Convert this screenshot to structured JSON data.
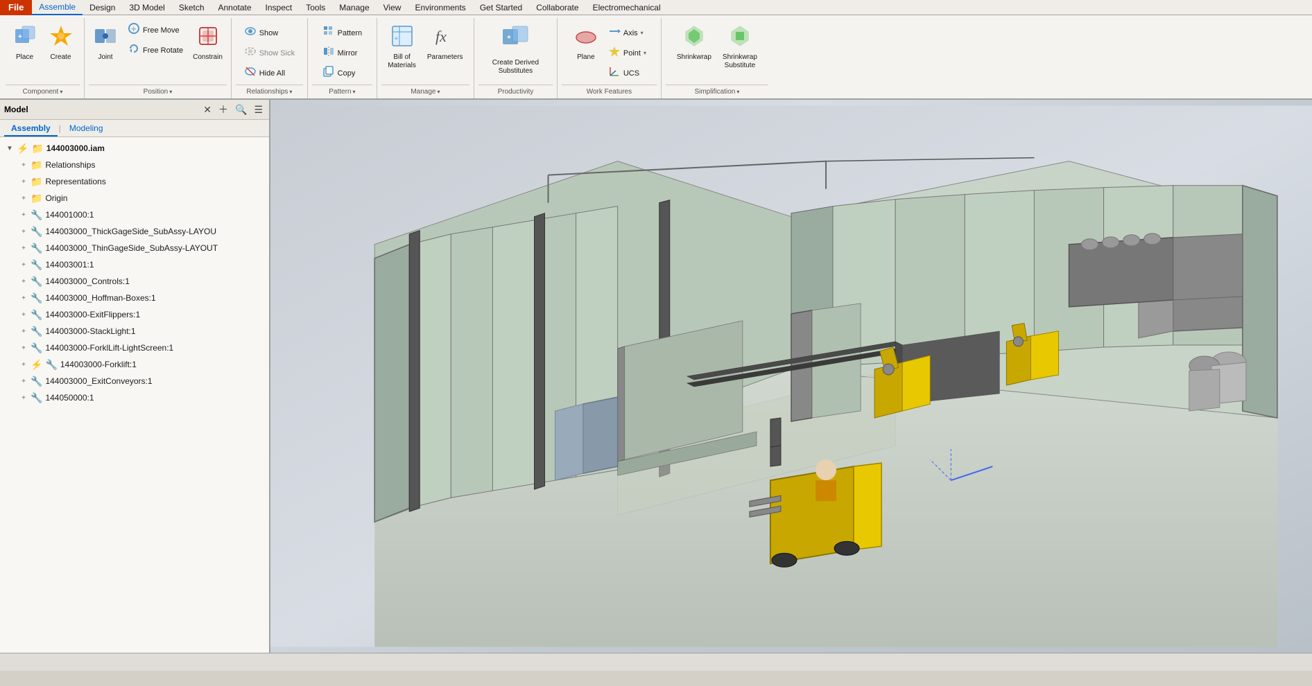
{
  "menubar": {
    "file_label": "File",
    "items": [
      "Assemble",
      "Design",
      "3D Model",
      "Sketch",
      "Annotate",
      "Inspect",
      "Tools",
      "Manage",
      "View",
      "Environments",
      "Get Started",
      "Collaborate",
      "Electromechanical"
    ]
  },
  "ribbon": {
    "groups": [
      {
        "id": "component",
        "label": "Component",
        "has_dropdown": true,
        "buttons_large": [
          {
            "id": "place",
            "label": "Place",
            "icon": "⬛"
          },
          {
            "id": "create",
            "label": "Create",
            "icon": "⭐"
          }
        ],
        "buttons_small": []
      },
      {
        "id": "position",
        "label": "Position",
        "has_dropdown": true,
        "buttons_large": [
          {
            "id": "joint",
            "label": "Joint",
            "icon": "🔗"
          },
          {
            "id": "constrain",
            "label": "Constrain",
            "icon": "🔴"
          }
        ],
        "buttons_small": [
          {
            "id": "free-move",
            "label": "Free Move",
            "icon": "⊕"
          },
          {
            "id": "free-rotate",
            "label": "Free Rotate",
            "icon": "↺"
          }
        ]
      },
      {
        "id": "relationships",
        "label": "Relationships",
        "has_dropdown": true,
        "buttons_large": [],
        "buttons_small": [
          {
            "id": "show",
            "label": "Show",
            "icon": "👁"
          },
          {
            "id": "show-sick",
            "label": "Show Sick",
            "icon": "👁"
          },
          {
            "id": "hide-all",
            "label": "Hide All",
            "icon": "👁"
          }
        ]
      },
      {
        "id": "pattern",
        "label": "Pattern",
        "has_dropdown": true,
        "buttons_large": [],
        "buttons_small": [
          {
            "id": "pattern-btn",
            "label": "Pattern",
            "icon": "⊞"
          },
          {
            "id": "mirror",
            "label": "Mirror",
            "icon": "⟺"
          },
          {
            "id": "copy",
            "label": "Copy",
            "icon": "⧉"
          }
        ]
      },
      {
        "id": "manage",
        "label": "Manage",
        "has_dropdown": true,
        "buttons_large": [
          {
            "id": "bom",
            "label": "Bill of\nMaterials",
            "icon": "📋"
          },
          {
            "id": "parameters",
            "label": "Parameters",
            "icon": "ƒx"
          }
        ],
        "buttons_small": []
      },
      {
        "id": "productivity",
        "label": "Productivity",
        "has_dropdown": false,
        "buttons_large": [
          {
            "id": "create-derived",
            "label": "Create Derived\nSubstitutes",
            "icon": "⬛"
          }
        ],
        "buttons_small": []
      },
      {
        "id": "work-features",
        "label": "Work Features",
        "has_dropdown": false,
        "buttons_large": [
          {
            "id": "plane",
            "label": "Plane",
            "icon": "⬜"
          }
        ],
        "buttons_small": [
          {
            "id": "axis",
            "label": "Axis",
            "icon": "⟶"
          },
          {
            "id": "point",
            "label": "Point",
            "icon": "◆"
          },
          {
            "id": "ucs",
            "label": "UCS",
            "icon": "⊕"
          }
        ]
      },
      {
        "id": "simplification",
        "label": "Simplification",
        "has_dropdown": true,
        "buttons_large": [
          {
            "id": "shrinkwrap",
            "label": "Shrinkwrap",
            "icon": "🟩"
          },
          {
            "id": "shrinkwrap-sub",
            "label": "Shrinkwrap\nSubstitute",
            "icon": "🟩"
          }
        ],
        "buttons_small": []
      }
    ]
  },
  "sidebar": {
    "title": "Model",
    "tabs": [
      "Assembly",
      "Modeling"
    ],
    "tree_items": [
      {
        "id": "root",
        "level": 0,
        "icon": "lightning+folder",
        "label": "144003000.iam",
        "bold": true,
        "has_expand": false
      },
      {
        "id": "relationships",
        "level": 1,
        "icon": "folder-yellow",
        "label": "Relationships",
        "bold": false,
        "has_expand": true
      },
      {
        "id": "representations",
        "level": 1,
        "icon": "folder-special",
        "label": "Representations",
        "bold": false,
        "has_expand": true
      },
      {
        "id": "origin",
        "level": 1,
        "icon": "folder-yellow",
        "label": "Origin",
        "bold": false,
        "has_expand": true
      },
      {
        "id": "item1",
        "level": 1,
        "icon": "component",
        "label": "144001000:1",
        "bold": false,
        "has_expand": true
      },
      {
        "id": "item2",
        "level": 1,
        "icon": "component",
        "label": "144003000_ThickGageSide_SubAssy-LAYOU",
        "bold": false,
        "has_expand": true
      },
      {
        "id": "item3",
        "level": 1,
        "icon": "component",
        "label": "144003000_ThinGageSide_SubAssy-LAYOUT",
        "bold": false,
        "has_expand": true
      },
      {
        "id": "item4",
        "level": 1,
        "icon": "component",
        "label": "144003001:1",
        "bold": false,
        "has_expand": true
      },
      {
        "id": "item5",
        "level": 1,
        "icon": "component",
        "label": "144003000_Controls:1",
        "bold": false,
        "has_expand": true
      },
      {
        "id": "item6",
        "level": 1,
        "icon": "component",
        "label": "144003000_Hoffman-Boxes:1",
        "bold": false,
        "has_expand": true
      },
      {
        "id": "item7",
        "level": 1,
        "icon": "component",
        "label": "144003000-ExitFlippers:1",
        "bold": false,
        "has_expand": true
      },
      {
        "id": "item8",
        "level": 1,
        "icon": "component",
        "label": "144003000-StackLight:1",
        "bold": false,
        "has_expand": true
      },
      {
        "id": "item9",
        "level": 1,
        "icon": "component",
        "label": "144003000-ForklLift-LightScreen:1",
        "bold": false,
        "has_expand": true
      },
      {
        "id": "item10",
        "level": 1,
        "icon": "lightning+component",
        "label": "144003000-Forklift:1",
        "bold": false,
        "has_expand": true
      },
      {
        "id": "item11",
        "level": 1,
        "icon": "component",
        "label": "144003000_ExitConveyors:1",
        "bold": false,
        "has_expand": true
      },
      {
        "id": "item12",
        "level": 1,
        "icon": "component",
        "label": "144050000:1",
        "bold": false,
        "has_expand": true
      }
    ]
  },
  "statusbar": {
    "text": ""
  }
}
